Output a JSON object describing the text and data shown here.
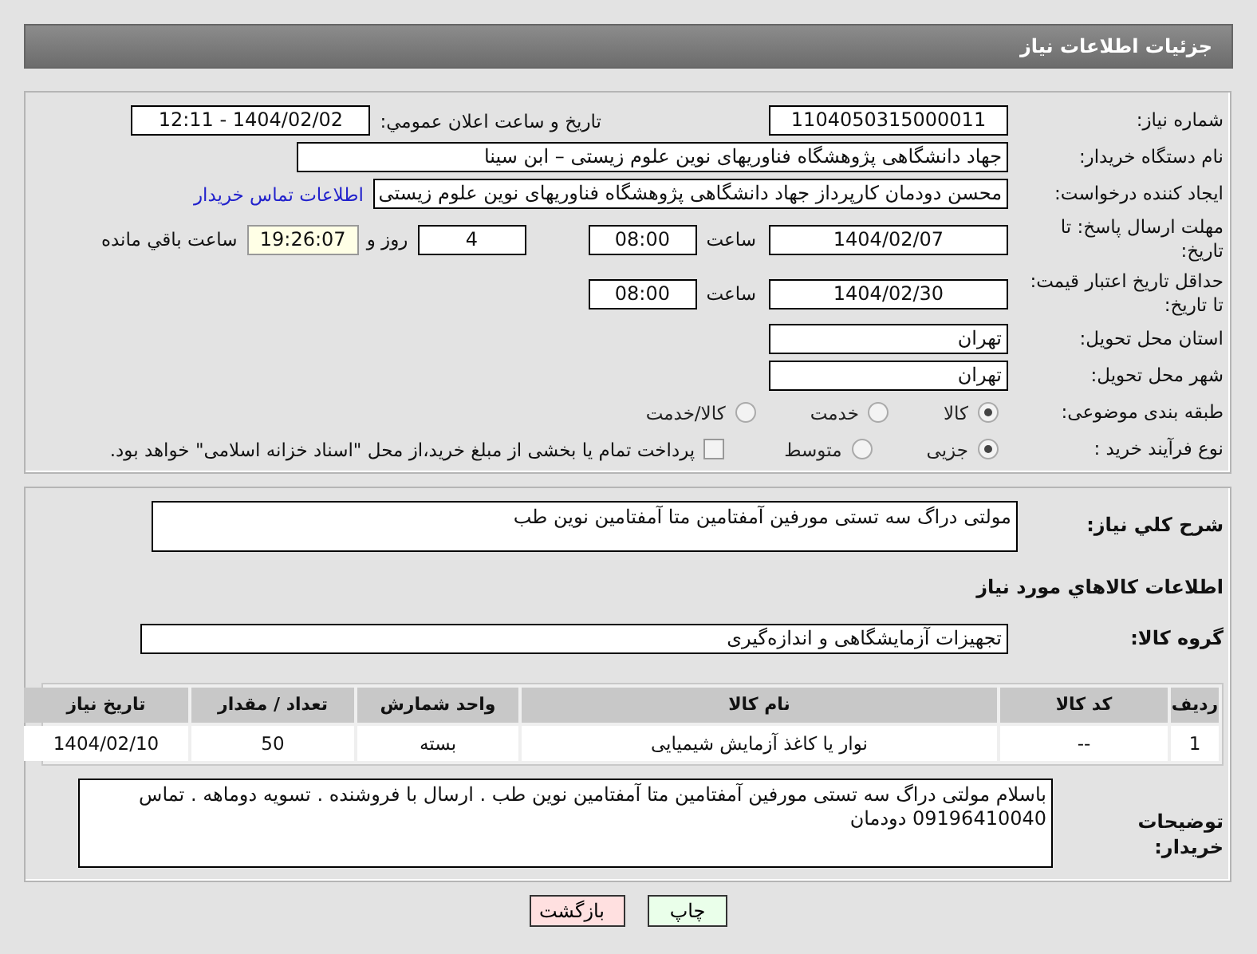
{
  "header": {
    "title": "جزئیات اطلاعات نیاز"
  },
  "need_number": {
    "label": "شماره نیاز:",
    "value": "1104050315000011"
  },
  "announce": {
    "label": "تاریخ و ساعت اعلان عمومي:",
    "value": "1404/02/02 - 12:11"
  },
  "buyer_org": {
    "label": "نام دستگاه خریدار:",
    "value": "جهاد دانشگاهی پژوهشگاه فناوریهای نوین علوم زیستی – ابن سینا"
  },
  "requester": {
    "label": "ایجاد کننده درخواست:",
    "value": "محسن دودمان کارپرداز جهاد دانشگاهی پژوهشگاه فناوریهای نوین علوم زیستی",
    "link": "اطلاعات تماس خریدار"
  },
  "deadline": {
    "label": "مهلت ارسال پاسخ: تا تاریخ:",
    "date": "1404/02/07",
    "time_label": "ساعت",
    "time": "08:00",
    "days": "4",
    "days_label": "روز و",
    "remaining": "19:26:07",
    "remaining_label": "ساعت باقي مانده"
  },
  "price_validity": {
    "label": "حداقل تاریخ اعتبار قیمت: تا تاریخ:",
    "date": "1404/02/30",
    "time_label": "ساعت",
    "time": "08:00"
  },
  "province": {
    "label": "استان محل تحویل:",
    "value": "تهران"
  },
  "city": {
    "label": "شهر محل تحویل:",
    "value": "تهران"
  },
  "category": {
    "label": "طبقه بندی موضوعی:",
    "options": [
      {
        "label": "کالا",
        "selected": true,
        "disabled": true
      },
      {
        "label": "خدمت",
        "selected": false,
        "disabled": true
      },
      {
        "label": "کالا/خدمت",
        "selected": false,
        "disabled": true
      }
    ]
  },
  "process": {
    "label": "نوع فرآیند خرید :",
    "options": [
      {
        "label": "جزیی",
        "selected": true,
        "disabled": true
      },
      {
        "label": "متوسط",
        "selected": false,
        "disabled": true
      }
    ],
    "treasury": {
      "label": "پرداخت تمام یا بخشی از مبلغ خرید،از محل \"اسناد خزانه اسلامی\" خواهد بود.",
      "checked": false,
      "disabled": true
    }
  },
  "description": {
    "label": "شرح کلي نیاز:",
    "value": "مولتی دراگ سه تستی مورفین آمفتامین متا آمفتامین نوین طب"
  },
  "goods_heading": "اطلاعات کالاهاي مورد نياز",
  "goods_group": {
    "label": "گروه کالا:",
    "value": "تجهیزات آزمایشگاهی و اندازه‌گیری"
  },
  "table": {
    "columns": [
      "ردیف",
      "کد کالا",
      "نام کالا",
      "واحد شمارش",
      "تعداد / مقدار",
      "تاریخ نیاز"
    ],
    "rows": [
      [
        "1",
        "--",
        "نوار یا کاغذ آزمایش شیمیایی",
        "بسته",
        "50",
        "1404/02/10"
      ]
    ]
  },
  "buyer_notes": {
    "label": "توضیحات خریدار:",
    "value": "باسلام مولتی دراگ سه تستی مورفین آمفتامین متا آمفتامین نوین طب . ارسال با فروشنده . تسویه دوماهه . تماس 09196410040 دودمان"
  },
  "buttons": [
    {
      "label": "چاپ",
      "kind": "print"
    },
    {
      "label": "بازگشت",
      "kind": "back"
    }
  ]
}
